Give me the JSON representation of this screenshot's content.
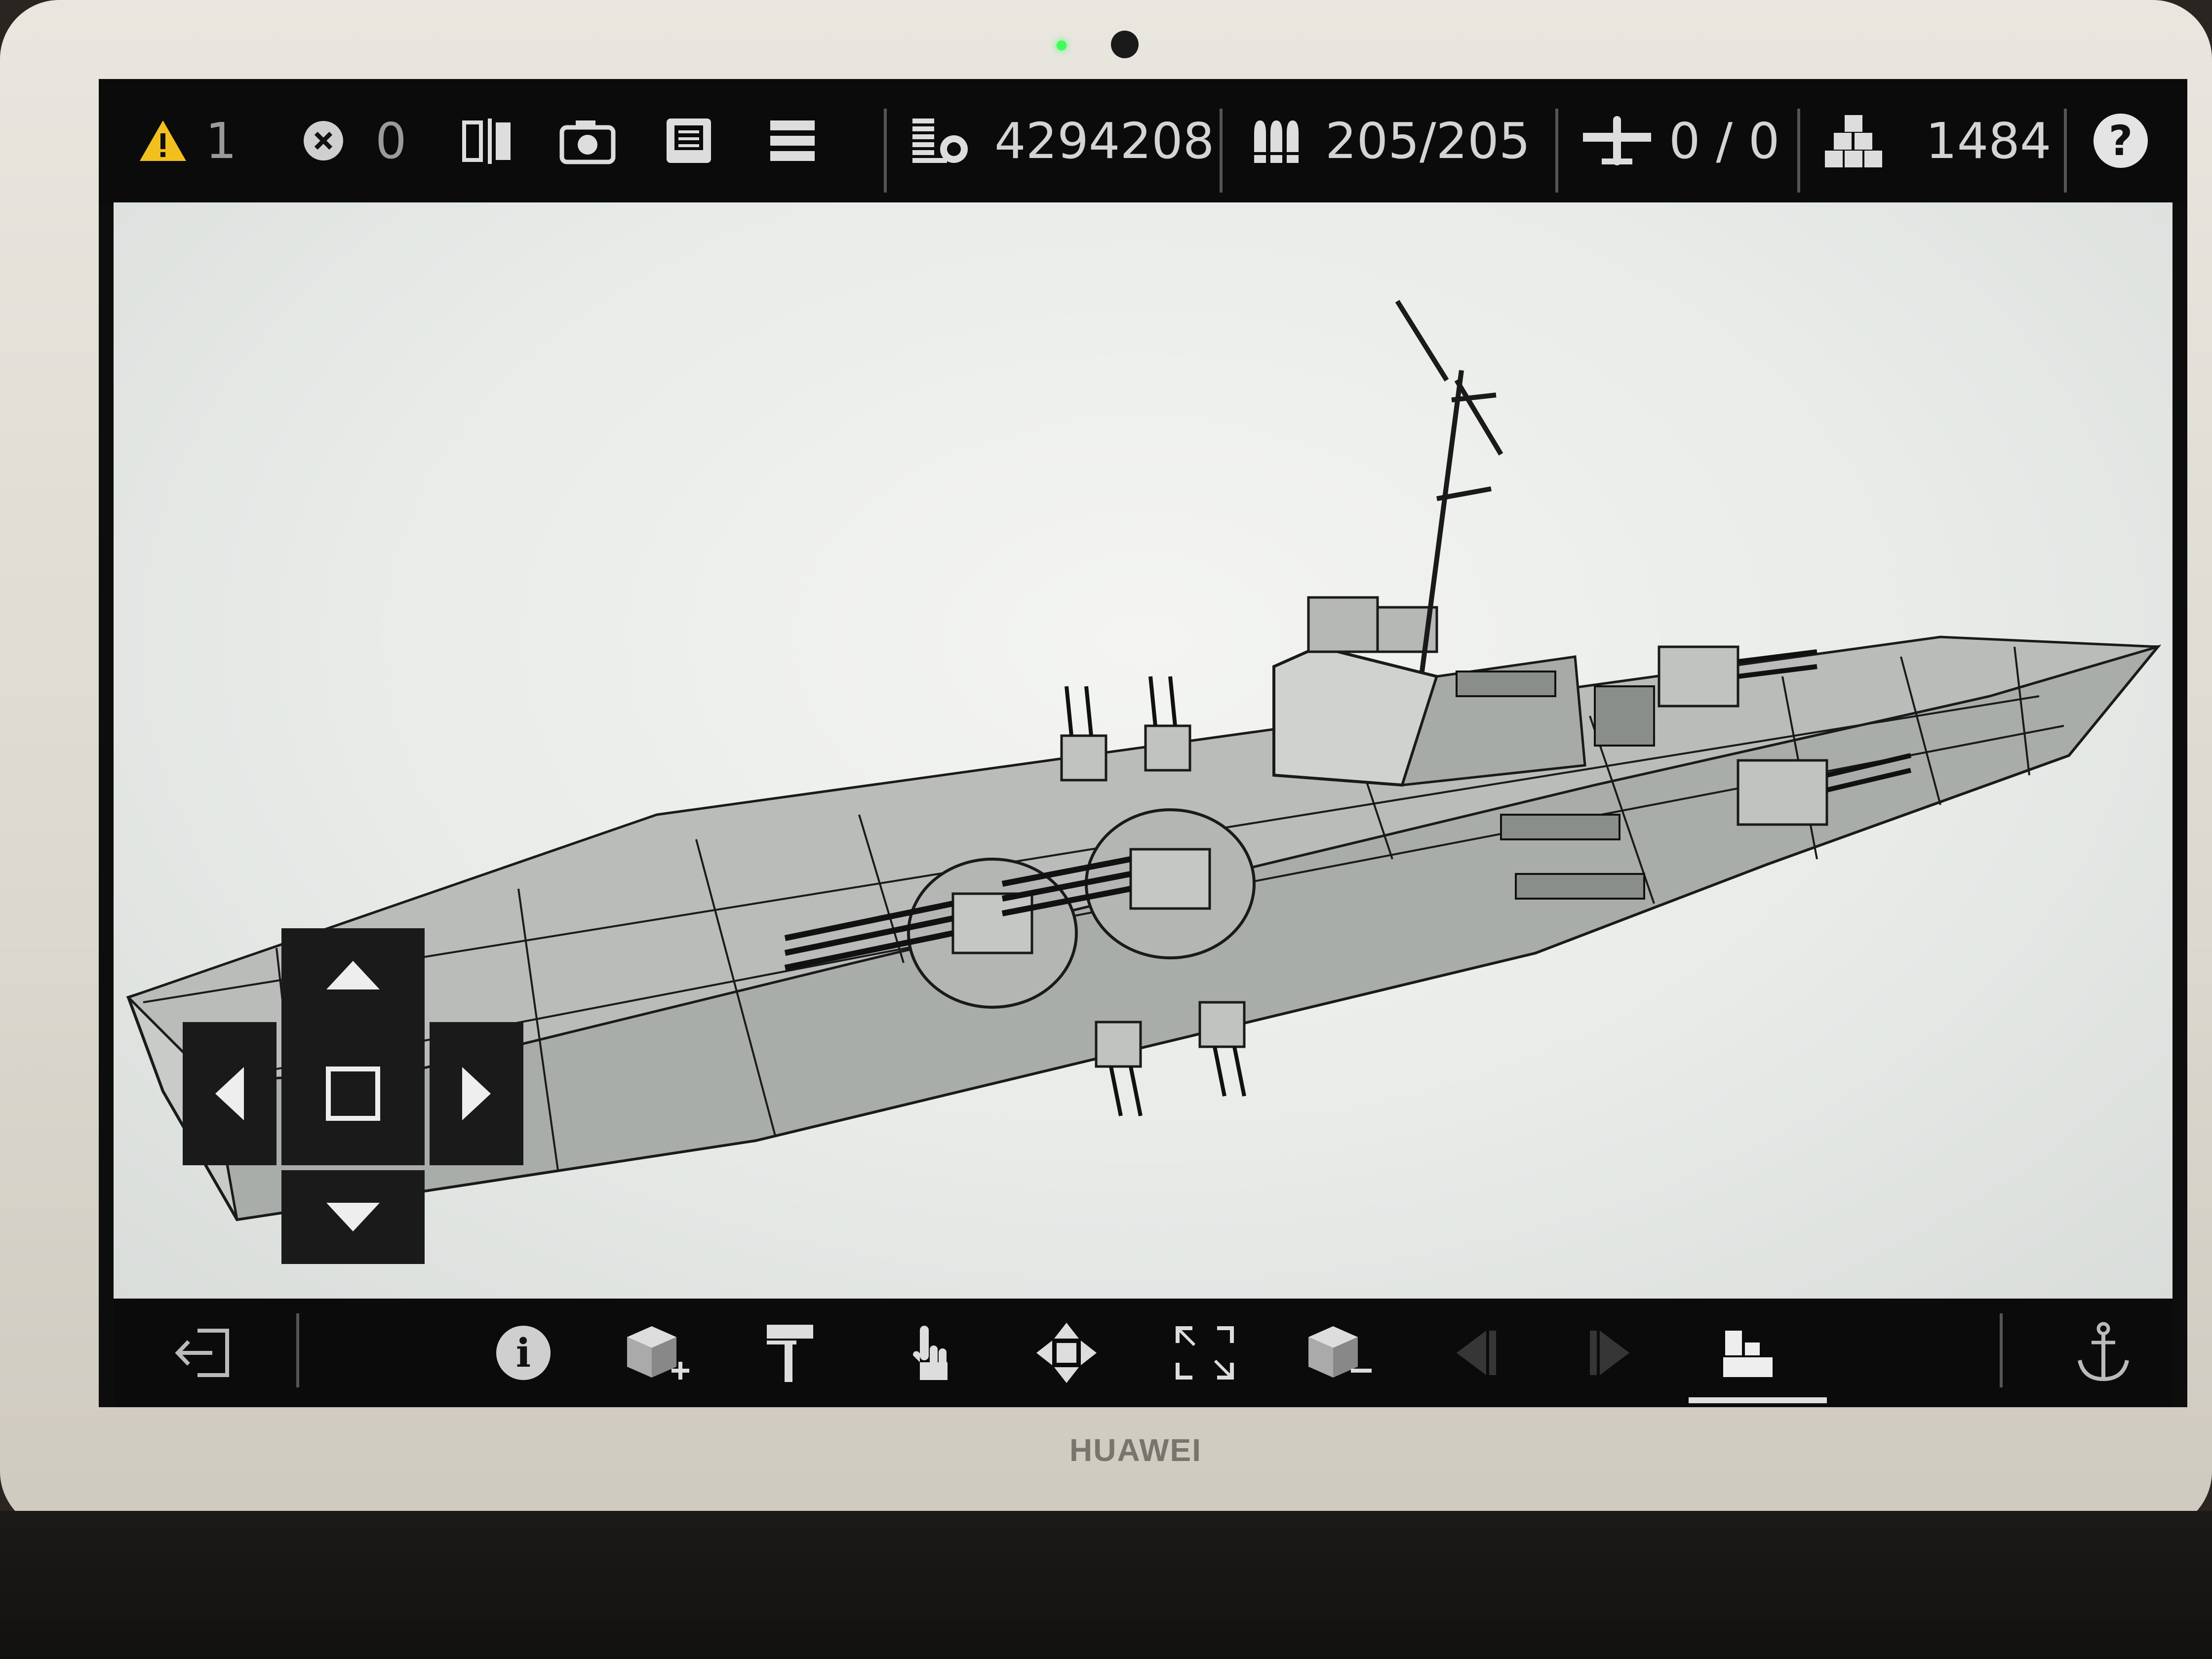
{
  "device": {
    "brand": "HUAWEI"
  },
  "topbar": {
    "warnings": {
      "icon": "warning-icon",
      "count": "1",
      "color": "#f2c01e"
    },
    "errors": {
      "icon": "error-icon",
      "count": "0"
    },
    "tools": [
      {
        "name": "mirror-icon"
      },
      {
        "name": "camera-icon"
      },
      {
        "name": "save-icon"
      },
      {
        "name": "menu-icon"
      }
    ],
    "stats": {
      "cost": {
        "icon": "cost-icon",
        "value": "4294208"
      },
      "ammo": {
        "icon": "ammo-icon",
        "value": "205/205"
      },
      "aircraft": {
        "icon": "aircraft-icon",
        "value": "0 / 0"
      },
      "blocks": {
        "icon": "blocks-icon",
        "value": "1484"
      }
    },
    "help": {
      "icon": "help-icon",
      "label": "?"
    }
  },
  "viewport": {
    "model": "warship-wireframe",
    "dpad": [
      "up-arrow-icon",
      "left-arrow-icon",
      "center-square-icon",
      "right-arrow-icon",
      "down-arrow-icon"
    ]
  },
  "bottombar": {
    "buttons": [
      {
        "name": "exit-icon"
      },
      {
        "name": "info-icon",
        "label": "i"
      },
      {
        "name": "add-block-icon"
      },
      {
        "name": "paint-roller-icon"
      },
      {
        "name": "hand-select-icon"
      },
      {
        "name": "move-icon"
      },
      {
        "name": "resize-icon"
      },
      {
        "name": "remove-block-icon"
      },
      {
        "name": "undo-icon",
        "disabled": true
      },
      {
        "name": "redo-icon",
        "disabled": true
      },
      {
        "name": "build-mode-icon",
        "active": true
      },
      {
        "name": "anchor-icon"
      }
    ]
  }
}
